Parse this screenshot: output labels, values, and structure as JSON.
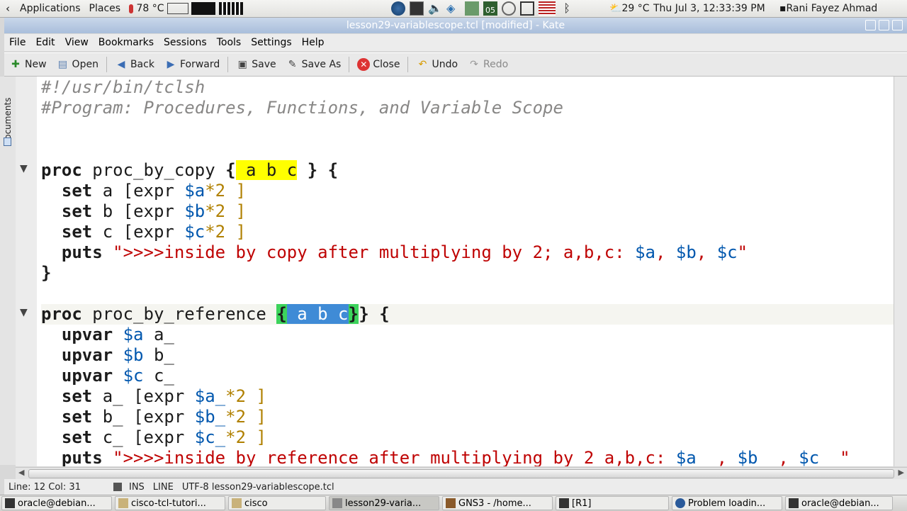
{
  "topbar": {
    "apps": "Applications",
    "places": "Places",
    "temp1": "78 °C",
    "weather": "29 °C",
    "clock": "Thu Jul  3, 12:33:39 PM",
    "user": "Rani Fayez Ahmad",
    "clock_badge": "05"
  },
  "window": {
    "title": "lesson29-variablescope.tcl [modified] - Kate"
  },
  "menu": [
    "File",
    "Edit",
    "View",
    "Bookmarks",
    "Sessions",
    "Tools",
    "Settings",
    "Help"
  ],
  "toolbar": {
    "new": "New",
    "open": "Open",
    "back": "Back",
    "forward": "Forward",
    "save": "Save",
    "save_as": "Save As",
    "close": "Close",
    "undo": "Undo",
    "redo": "Redo"
  },
  "sidebar": {
    "documents": "Documents"
  },
  "code": {
    "l1": "#!/usr/bin/tclsh",
    "l2": "#Program: Procedures, Functions, and Variable Scope",
    "p1_kw": "proc",
    "p1_name": " proc_by_copy ",
    "p1_open": "{",
    "p1_args": " a b c",
    "p1_close": " } {",
    "set": "set",
    "puts": "puts",
    "upvar": "upvar",
    "a1": " a [expr ",
    "va": "$a",
    "tail": "*2 ]",
    "b1": " b [expr ",
    "vb": "$b",
    "c1": " c [expr ",
    "vc": "$c",
    "s1_str": " \">>>>inside by copy after multiplying by 2; a,b,c: ",
    "s1_end": "\"",
    "comma": ", ",
    "brace": "}",
    "p2_name": " proc_by_reference ",
    "p2_sel": " a b c",
    "p2_close": "} {",
    "ua": " a_",
    "ub": " b_",
    "uc": " c_",
    "a2": " a_ [expr ",
    "va2": "$a_",
    "b2": " b_ [expr ",
    "vb2": "$b_",
    "c2": " c_ [expr ",
    "vc2": "$c_",
    "tail2": "*2 ]",
    "s2_str": " \">>>>inside by reference after multiplying by 2 a,b,c: ",
    "va3": "$a_",
    "vb3": "$b_",
    "vc3": "$c_",
    "s2_end": " \"",
    "sp": " ",
    "comma2": " , "
  },
  "status": {
    "pos": "Line: 12 Col: 31",
    "ins": "INS",
    "line": "LINE",
    "enc": "UTF-8 lesson29-variablescope.tcl"
  },
  "taskbar": [
    "oracle@debian...",
    "cisco-tcl-tutori...",
    "cisco",
    "lesson29-varia...",
    "GNS3 - /home...",
    "[R1]",
    "Problem loadin...",
    "oracle@debian..."
  ],
  "colors": {
    "keyword": "#1b1b1b",
    "variable": "#0057ae",
    "number": "#b08000",
    "string": "#bf0303",
    "comment": "#888786",
    "bracket_match": "#3cd35c",
    "highlight": "#ffff00",
    "selection": "#3f8bd6"
  }
}
